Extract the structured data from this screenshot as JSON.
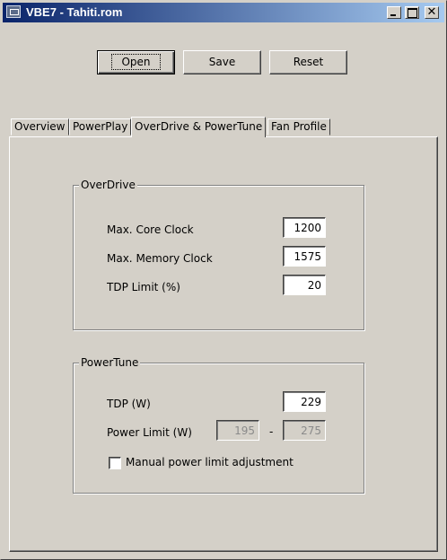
{
  "window": {
    "title": "VBE7 - Tahiti.rom",
    "app_icon": "gpu-card-icon",
    "caption_buttons": {
      "minimize": "minimize-icon",
      "maximize": "maximize-icon",
      "close": "close-icon",
      "close_glyph": "✕"
    }
  },
  "toolbar": {
    "open_label": "Open",
    "save_label": "Save",
    "reset_label": "Reset"
  },
  "tabs": [
    {
      "label": "Overview",
      "active": false
    },
    {
      "label": "PowerPlay",
      "active": false
    },
    {
      "label": "OverDrive & PowerTune",
      "active": true
    },
    {
      "label": "Fan Profile",
      "active": false
    }
  ],
  "overdrive": {
    "title": "OverDrive",
    "max_core_clock": {
      "label": "Max. Core Clock",
      "value": "1200"
    },
    "max_memory_clock": {
      "label": "Max. Memory Clock",
      "value": "1575"
    },
    "tdp_limit": {
      "label": "TDP Limit (%)",
      "value": "20"
    }
  },
  "powertune": {
    "title": "PowerTune",
    "tdp": {
      "label": "TDP (W)",
      "value": "229"
    },
    "power_limit": {
      "label": "Power Limit (W)",
      "min": "195",
      "separator": "-",
      "max": "275"
    },
    "manual_adjustment": {
      "label": "Manual power limit adjustment",
      "checked": false
    }
  }
}
